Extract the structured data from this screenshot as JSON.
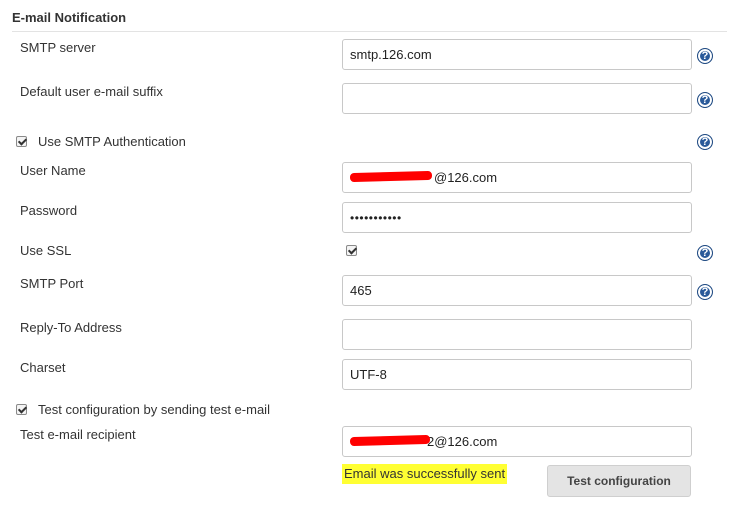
{
  "section": {
    "title": "E-mail Notification"
  },
  "labels": {
    "smtp_server": "SMTP server",
    "default_suffix": "Default user e-mail suffix",
    "use_smtp_auth": "Use SMTP Authentication",
    "user_name": "User Name",
    "password": "Password",
    "use_ssl": "Use SSL",
    "smtp_port": "SMTP Port",
    "reply_to": "Reply-To Address",
    "charset": "Charset",
    "test_config": "Test configuration by sending test e-mail",
    "test_recipient": "Test e-mail recipient"
  },
  "fields": {
    "smtp_server": "smtp.126.com",
    "default_suffix": "",
    "user_name_visible": "@126.com",
    "password": "•••••••••••",
    "smtp_port": "465",
    "reply_to": "",
    "charset": "UTF-8",
    "test_recipient_visible": "@126.com",
    "test_recipient_partial": "2"
  },
  "checkboxes": {
    "use_smtp_auth": true,
    "use_ssl": true,
    "test_config": true
  },
  "status": {
    "success_message": "Email was successfully sent"
  },
  "buttons": {
    "test_configuration": "Test configuration"
  },
  "icons": {
    "help": "help-icon"
  },
  "colors": {
    "help_blue": "#2a5a9a",
    "success_highlight": "#ffff33",
    "redaction": "#ff0000"
  }
}
